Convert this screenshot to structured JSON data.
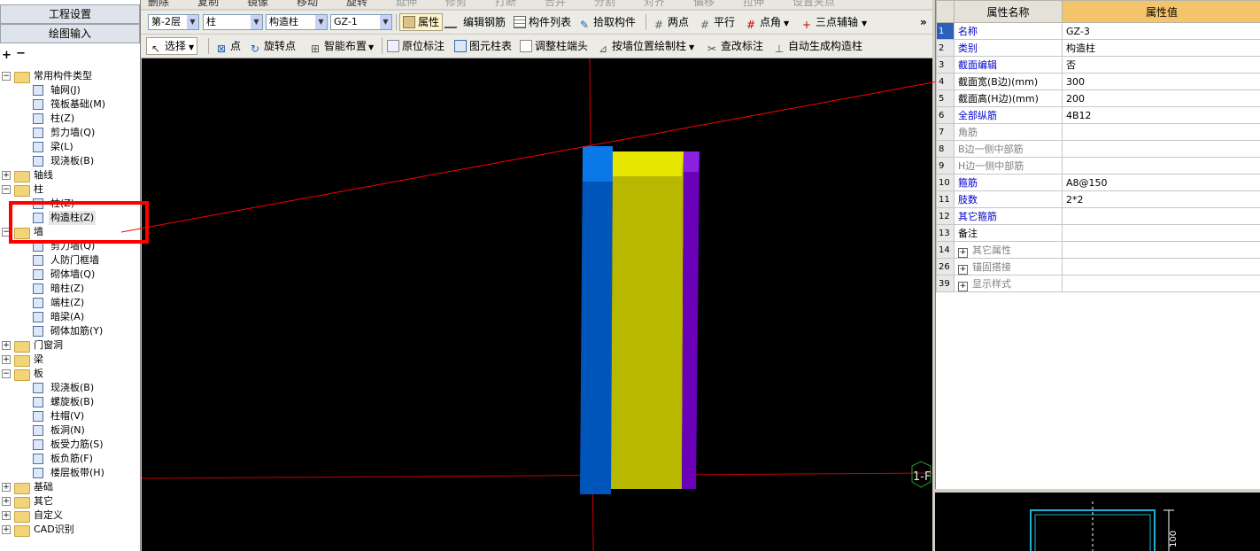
{
  "nav": {
    "project_settings": "工程设置",
    "drawing_input": "绘图输入"
  },
  "tree": [
    {
      "label": "常用构件类型",
      "level": 0,
      "expanded": true
    },
    {
      "label": "轴网(J)",
      "level": 1
    },
    {
      "label": "筏板基础(M)",
      "level": 1
    },
    {
      "label": "柱(Z)",
      "level": 1
    },
    {
      "label": "剪力墙(Q)",
      "level": 1
    },
    {
      "label": "梁(L)",
      "level": 1
    },
    {
      "label": "现浇板(B)",
      "level": 1
    },
    {
      "label": "轴线",
      "level": 0,
      "expanded": false
    },
    {
      "label": "柱",
      "level": 0,
      "expanded": true
    },
    {
      "label": "柱(Z)",
      "level": 1
    },
    {
      "label": "构造柱(Z)",
      "level": 1,
      "selected": true
    },
    {
      "label": "墙",
      "level": 0,
      "expanded": true
    },
    {
      "label": "剪力墙(Q)",
      "level": 1
    },
    {
      "label": "人防门框墙",
      "level": 1
    },
    {
      "label": "砌体墙(Q)",
      "level": 1
    },
    {
      "label": "暗柱(Z)",
      "level": 1
    },
    {
      "label": "端柱(Z)",
      "level": 1
    },
    {
      "label": "暗梁(A)",
      "level": 1
    },
    {
      "label": "砌体加筋(Y)",
      "level": 1
    },
    {
      "label": "门窗洞",
      "level": 0,
      "expanded": false
    },
    {
      "label": "梁",
      "level": 0,
      "expanded": false
    },
    {
      "label": "板",
      "level": 0,
      "expanded": true
    },
    {
      "label": "现浇板(B)",
      "level": 1
    },
    {
      "label": "螺旋板(B)",
      "level": 1
    },
    {
      "label": "柱帽(V)",
      "level": 1
    },
    {
      "label": "板洞(N)",
      "level": 1
    },
    {
      "label": "板受力筋(S)",
      "level": 1
    },
    {
      "label": "板负筋(F)",
      "level": 1
    },
    {
      "label": "楼层板带(H)",
      "level": 1
    },
    {
      "label": "基础",
      "level": 0,
      "expanded": false
    },
    {
      "label": "其它",
      "level": 0,
      "expanded": false
    },
    {
      "label": "自定义",
      "level": 0,
      "expanded": false
    },
    {
      "label": "CAD识别",
      "level": 0,
      "expanded": false
    }
  ],
  "toolbar_top": [
    "删除",
    "复制",
    "镜像",
    "移动",
    "旋转",
    "延伸",
    "修剪",
    "打断",
    "合并",
    "分割",
    "对齐",
    "偏移",
    "拉伸",
    "设置夹点"
  ],
  "toolbar1": {
    "floor": "第-2层",
    "category": "柱",
    "type": "构造柱",
    "element": "GZ-1",
    "properties": "属性",
    "edit_rebar": "编辑钢筋",
    "component_list": "构件列表",
    "pick_component": "拾取构件",
    "two_points": "两点",
    "parallel": "平行",
    "point_angle": "点角",
    "three_point_axis": "三点辅轴",
    "more": "»"
  },
  "toolbar2": {
    "select": "选择",
    "point": "点",
    "rotate_point": "旋转点",
    "smart_layout": "智能布置",
    "in_place_annotation": "原位标注",
    "element_column_table": "图元柱表",
    "adjust_column_end": "调整柱端头",
    "draw_by_wall": "按墙位置绘制柱",
    "modify_annotation": "查改标注",
    "auto_generate": "自动生成构造柱"
  },
  "canvas": {
    "axis_label": "1-F"
  },
  "property_grid": {
    "header_name": "属性名称",
    "header_value": "属性值",
    "rows": [
      {
        "num": "1",
        "name": "名称",
        "value": "GZ-3",
        "style": "blue"
      },
      {
        "num": "2",
        "name": "类别",
        "value": "构造柱",
        "style": "blue"
      },
      {
        "num": "3",
        "name": "截面编辑",
        "value": "否",
        "style": "blue"
      },
      {
        "num": "4",
        "name": "截面宽(B边)(mm)",
        "value": "300",
        "style": "normal"
      },
      {
        "num": "5",
        "name": "截面高(H边)(mm)",
        "value": "200",
        "style": "normal"
      },
      {
        "num": "6",
        "name": "全部纵筋",
        "value": "4B12",
        "style": "blue"
      },
      {
        "num": "7",
        "name": "角筋",
        "value": "",
        "style": "gray"
      },
      {
        "num": "8",
        "name": "B边一侧中部筋",
        "value": "",
        "style": "gray"
      },
      {
        "num": "9",
        "name": "H边一侧中部筋",
        "value": "",
        "style": "gray"
      },
      {
        "num": "10",
        "name": "箍筋",
        "value": "A8@150",
        "style": "blue"
      },
      {
        "num": "11",
        "name": "肢数",
        "value": "2*2",
        "style": "blue"
      },
      {
        "num": "12",
        "name": "其它箍筋",
        "value": "",
        "style": "blue"
      },
      {
        "num": "13",
        "name": "备注",
        "value": "",
        "style": "normal"
      },
      {
        "num": "14",
        "name": "其它属性",
        "value": "",
        "style": "gray",
        "expander": true
      },
      {
        "num": "26",
        "name": "锚固搭接",
        "value": "",
        "style": "gray",
        "expander": true
      },
      {
        "num": "39",
        "name": "显示样式",
        "value": "",
        "style": "gray",
        "expander": true
      }
    ]
  },
  "preview": {
    "dim_label": "100"
  },
  "colors": {
    "canvas_bg": "#000000",
    "axis_line": "#cc0000",
    "column_blue": "#0055bb",
    "column_yellow": "#b8b800",
    "column_purple": "#6a00b8",
    "highlight_box": "#ff0000",
    "header_value_bg": "#f4c46a"
  }
}
